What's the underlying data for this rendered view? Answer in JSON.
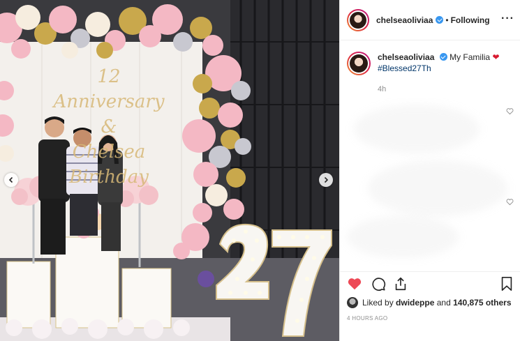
{
  "post": {
    "username": "chelseaoliviaa",
    "follow_state": "Following",
    "separator": "•",
    "more_label": "···"
  },
  "caption": {
    "username": "chelseaoliviaa",
    "text": "My Familia",
    "hashtag": "#Blessed27Th",
    "age": "4h"
  },
  "photo_text": {
    "line1": "12 Anniversary",
    "line2": "&",
    "line3": "Chelsea",
    "line4": "Birthday",
    "number": "27"
  },
  "likes": {
    "prefix": "Liked by",
    "liker": "dwideppe",
    "joiner": "and",
    "count_label": "140,875 others"
  },
  "timestamp": "4 HOURS AGO",
  "colors": {
    "like_red": "#ed4956",
    "verified_blue": "#3897f0",
    "hashtag_blue": "#003569",
    "balloon_pink": "#f4b8c4",
    "balloon_gold": "#c9a84c"
  },
  "icons": [
    "heart-icon",
    "comment-icon",
    "share-icon",
    "bookmark-icon",
    "chevron-left-icon",
    "chevron-right-icon",
    "verified-icon"
  ]
}
